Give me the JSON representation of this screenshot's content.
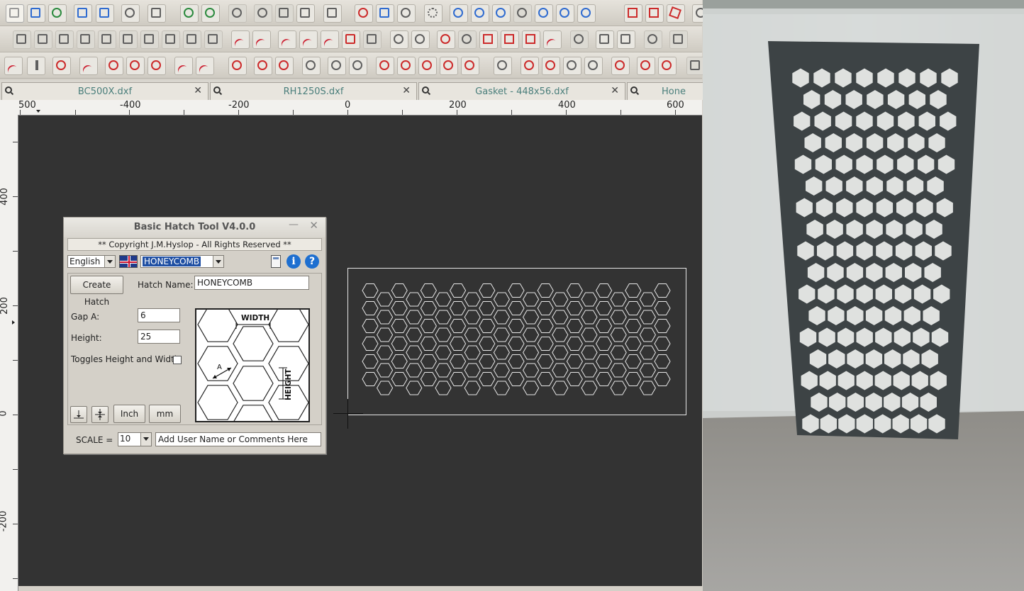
{
  "tabs": [
    {
      "label": "BC500X.dxf"
    },
    {
      "label": "RH1250S.dxf"
    },
    {
      "label": "Gasket - 448x56.dxf"
    },
    {
      "label": "Hone"
    }
  ],
  "ruler": {
    "top": [
      "500",
      "-400",
      "-200",
      "0",
      "200",
      "400",
      "600"
    ],
    "left": [
      "400",
      "200",
      "0",
      "-200"
    ]
  },
  "dialog": {
    "title": "Basic Hatch Tool V4.0.0",
    "copyright": "** Copyright J.M.Hyslop -  All Rights Reserved **",
    "language": "English",
    "pattern": "HONEYCOMB",
    "create_button": "Create Hatch",
    "hatch_name_label": "Hatch Name:",
    "hatch_name_value": "HONEYCOMB",
    "gap_label": "Gap A:",
    "gap_value": "6",
    "height_label": "Height:",
    "height_value": "25",
    "toggle_label": "Toggles Height and Width:",
    "inch_button": "Inch",
    "mm_button": "mm",
    "scale_label": "SCALE =",
    "scale_value": "10",
    "comments_value": "Add User Name or Comments Here",
    "diagram_width": "WIDTH",
    "diagram_height": "HEIGHT",
    "diagram_gap": "A"
  },
  "icons": {
    "info": "i",
    "help": "?"
  },
  "colors": {
    "canvas": "#333333",
    "tab_text": "#4a7e7b",
    "info_blue": "#1e6fd0",
    "selection": "#1f4fa3"
  }
}
